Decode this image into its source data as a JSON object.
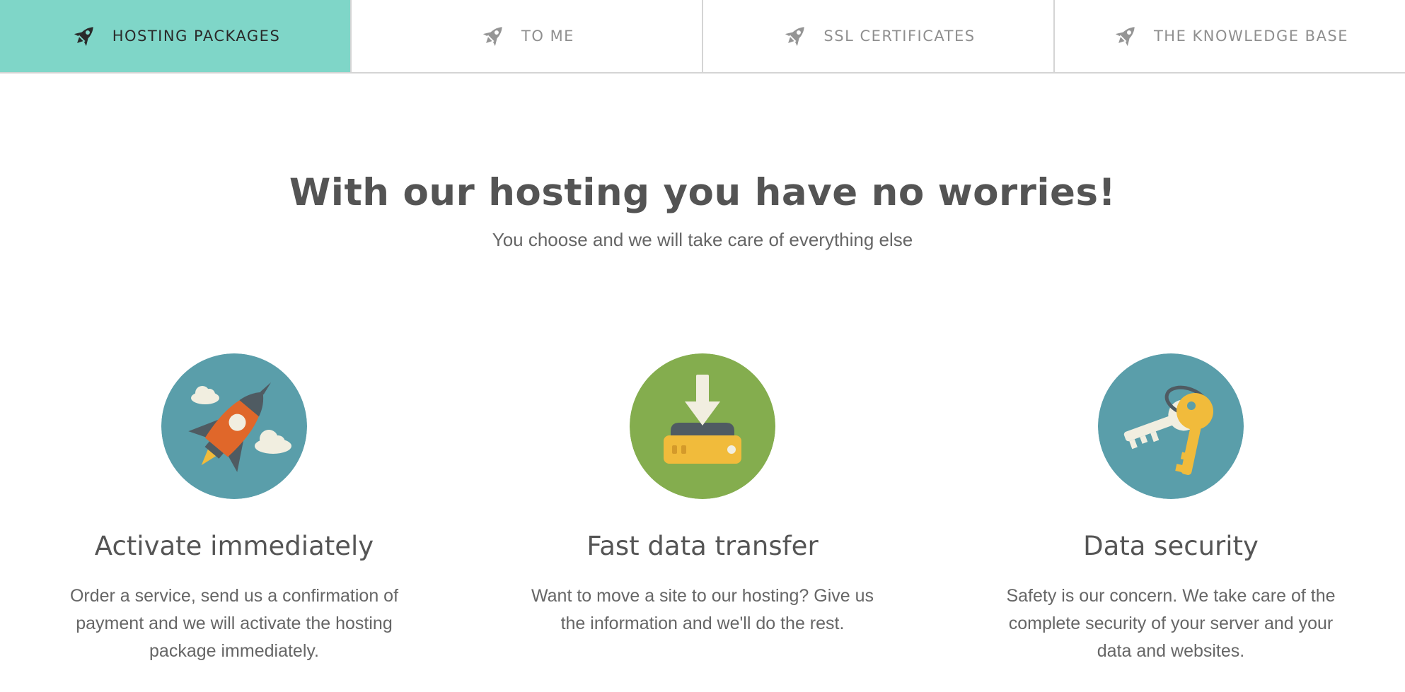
{
  "tabs": [
    {
      "label": "HOSTING PACKAGES",
      "icon": "rocket-icon",
      "active": true
    },
    {
      "label": "TO ME",
      "icon": "rocket-icon",
      "active": false
    },
    {
      "label": "SSL CERTIFICATES",
      "icon": "rocket-icon",
      "active": false
    },
    {
      "label": "THE KNOWLEDGE BASE",
      "icon": "rocket-icon",
      "active": false
    }
  ],
  "hero": {
    "title": "With our hosting you have no worries!",
    "subtitle": "You choose and we will take care of everything else"
  },
  "features": [
    {
      "icon": "rocket-launch-icon",
      "title": "Activate immediately",
      "description": "Order a service, send us a confirmation of payment and we will activate the hosting package immediately."
    },
    {
      "icon": "download-drive-icon",
      "title": "Fast data transfer",
      "description": "Want to move a site to our hosting? Give us the information and we'll do the rest."
    },
    {
      "icon": "keys-icon",
      "title": "Data security",
      "description": "Safety is our concern. We take care of the complete security of your server and your data and websites."
    }
  ],
  "colors": {
    "active_tab": "#7fd6c8",
    "teal_circle": "#5a9eaa",
    "green_circle": "#84ad4e",
    "orange": "#e0672a",
    "yellow": "#f1bb3b",
    "cream": "#f1eee0",
    "dark": "#4f5b62"
  }
}
